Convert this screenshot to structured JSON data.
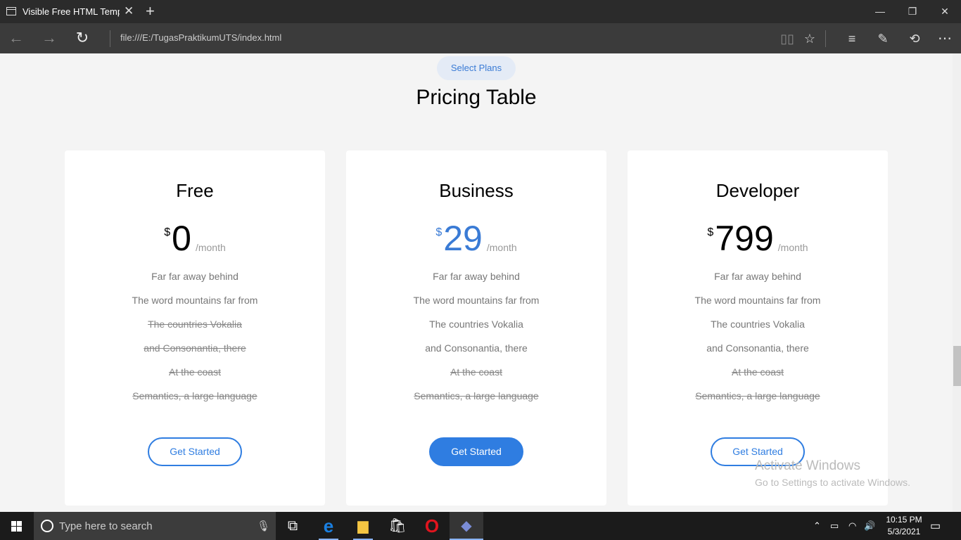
{
  "browser": {
    "tab_title": "Visible Free HTML Temp",
    "tab_close": "✕",
    "new_tab": "+",
    "url": "file:///E:/TugasPraktikumUTS/index.html",
    "window_controls": {
      "minimize": "—",
      "maximize": "❐",
      "close": "✕"
    },
    "nav": {
      "back": "←",
      "forward": "→",
      "refresh": "↻"
    },
    "toolbar_icons": [
      "reading-view-icon",
      "favorite-star-icon",
      "hub-icon",
      "web-note-icon",
      "share-icon",
      "more-icon"
    ],
    "toolbar_glyphs": {
      "reading": "▯▯",
      "favorite": "☆",
      "hub": "≡",
      "note": "✎",
      "share": "⟲",
      "more": "⋯"
    }
  },
  "page": {
    "subheading": "Select Plans",
    "heading": "Pricing Table",
    "accent_color": "#2f7de1",
    "plans": [
      {
        "name": "Free",
        "currency": "$",
        "amount": "0",
        "period": "/month",
        "button": "Get Started",
        "features": [
          {
            "text": "Far far away behind",
            "included": true
          },
          {
            "text": "The word mountains far from",
            "included": true
          },
          {
            "text": "The countries Vokalia",
            "included": false
          },
          {
            "text": "and Consonantia, there",
            "included": false
          },
          {
            "text": "At the coast",
            "included": false
          },
          {
            "text": "Semantics, a large language",
            "included": false
          }
        ]
      },
      {
        "name": "Business",
        "currency": "$",
        "amount": "29",
        "period": "/month",
        "button": "Get Started",
        "features": [
          {
            "text": "Far far away behind",
            "included": true
          },
          {
            "text": "The word mountains far from",
            "included": true
          },
          {
            "text": "The countries Vokalia",
            "included": true
          },
          {
            "text": "and Consonantia, there",
            "included": true
          },
          {
            "text": "At the coast",
            "included": false
          },
          {
            "text": "Semantics, a large language",
            "included": false
          }
        ]
      },
      {
        "name": "Developer",
        "currency": "$",
        "amount": "799",
        "period": "/month",
        "button": "Get Started",
        "features": [
          {
            "text": "Far far away behind",
            "included": true
          },
          {
            "text": "The word mountains far from",
            "included": true
          },
          {
            "text": "The countries Vokalia",
            "included": true
          },
          {
            "text": "and Consonantia, there",
            "included": true
          },
          {
            "text": "At the coast",
            "included": false
          },
          {
            "text": "Semantics, a large language",
            "included": false
          }
        ]
      }
    ],
    "watermark": {
      "title": "Activate Windows",
      "subtitle": "Go to Settings to activate Windows."
    }
  },
  "taskbar": {
    "search_placeholder": "Type here to search",
    "mic": "🎙",
    "task_view": "⧉",
    "edge": "e",
    "explorer": "▆",
    "store": "🛍",
    "opera": "O",
    "app": "◆",
    "tray": {
      "up": "⌃",
      "battery": "▭",
      "wifi": "◠",
      "volume": "🔊"
    },
    "time": "10:15 PM",
    "date": "5/3/2021",
    "notification": "▭"
  }
}
